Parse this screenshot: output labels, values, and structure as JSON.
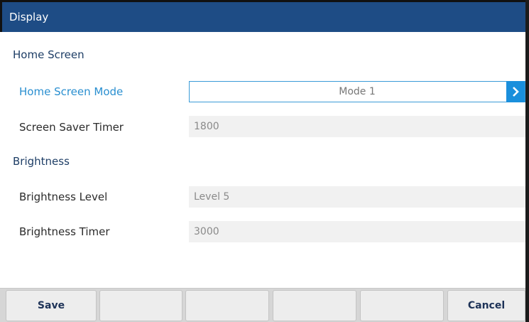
{
  "title": "Display",
  "sections": {
    "home_screen": {
      "header": "Home Screen",
      "mode_label": "Home Screen Mode",
      "mode_value": "Mode 1",
      "saver_label": "Screen Saver Timer",
      "saver_value": "1800"
    },
    "brightness": {
      "header": "Brightness",
      "level_label": "Brightness Level",
      "level_value": "Level 5",
      "timer_label": "Brightness Timer",
      "timer_value": "3000"
    }
  },
  "softkeys": {
    "save": "Save",
    "cancel": "Cancel"
  },
  "colors": {
    "title_bar": "#1e4c85",
    "accent": "#1a8fdc",
    "active_label": "#2a8fd0"
  },
  "icons": {
    "mode_arrow": "chevron-right-icon"
  }
}
